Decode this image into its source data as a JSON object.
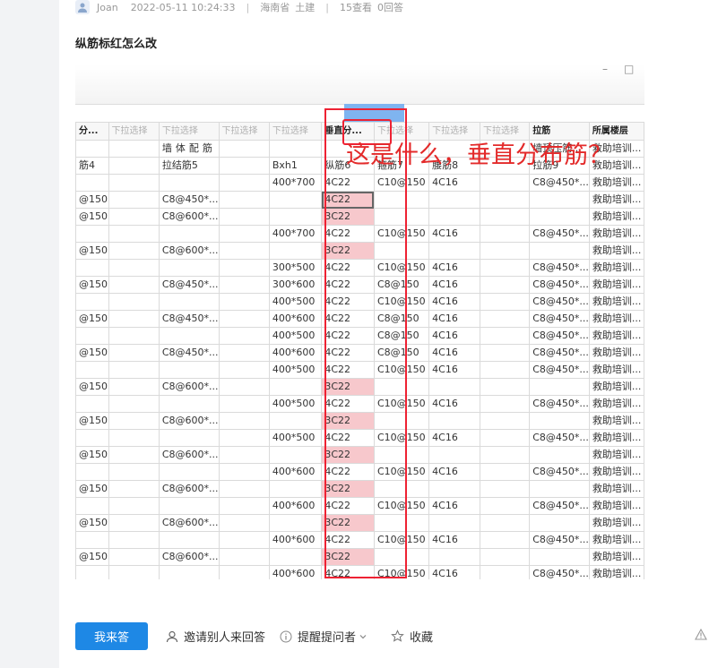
{
  "post": {
    "author": "Joan",
    "datetime": "2022-05-11 10:24:33",
    "separator": "|",
    "region": "海南省",
    "category": "土建",
    "views": "15查看",
    "answers": "0回答",
    "title": "纵筋标红怎么改"
  },
  "annotation": "这是什么，垂直分布筋？",
  "sheet": {
    "headers": [
      "分...",
      "下拉选择",
      "下拉选择",
      "下拉选择",
      "下拉选择",
      "垂直分...",
      "下拉选择",
      "下拉选择",
      "下拉选择",
      "拉筋",
      "所属楼层"
    ],
    "rows": [
      [
        "",
        "",
        "墙体配筋",
        "",
        "",
        "",
        "",
        "",
        "",
        "墙顶压筋...",
        "救助培训..."
      ],
      [
        "筋4",
        "",
        "拉结筋5",
        "",
        "Bxh1",
        "纵筋6",
        "箍筋7",
        "腰筋8",
        "",
        "拉筋9",
        "救助培训..."
      ],
      [
        "",
        "",
        "",
        "",
        "400*700",
        "4C22",
        "C10@150",
        "4C16",
        "",
        "C8@450*...",
        "救助培训..."
      ],
      [
        "@150",
        "",
        "C8@450*...",
        "",
        "",
        "4C22",
        "",
        "",
        "",
        "",
        "救助培训..."
      ],
      [
        "@150",
        "",
        "C8@600*...",
        "",
        "",
        "3C22",
        "",
        "",
        "",
        "",
        "救助培训..."
      ],
      [
        "",
        "",
        "",
        "",
        "400*700",
        "4C22",
        "C10@150",
        "4C16",
        "",
        "C8@450*...",
        "救助培训..."
      ],
      [
        "@150",
        "",
        "C8@600*...",
        "",
        "",
        "3C22",
        "",
        "",
        "",
        "",
        "救助培训..."
      ],
      [
        "",
        "",
        "",
        "",
        "300*500",
        "4C22",
        "C10@150",
        "4C16",
        "",
        "C8@450*...",
        "救助培训..."
      ],
      [
        "@150",
        "",
        "C8@450*...",
        "",
        "300*600",
        "4C22",
        "C8@150",
        "4C16",
        "",
        "C8@450*...",
        "救助培训..."
      ],
      [
        "",
        "",
        "",
        "",
        "400*500",
        "4C22",
        "C10@150",
        "4C16",
        "",
        "C8@450*...",
        "救助培训..."
      ],
      [
        "@150",
        "",
        "C8@450*...",
        "",
        "400*600",
        "4C22",
        "C8@150",
        "4C16",
        "",
        "C8@450*...",
        "救助培训..."
      ],
      [
        "",
        "",
        "",
        "",
        "400*500",
        "4C22",
        "C8@150",
        "4C16",
        "",
        "C8@450*...",
        "救助培训..."
      ],
      [
        "@150",
        "",
        "C8@450*...",
        "",
        "400*600",
        "4C22",
        "C8@150",
        "4C16",
        "",
        "C8@450*...",
        "救助培训..."
      ],
      [
        "",
        "",
        "",
        "",
        "400*500",
        "4C22",
        "C10@150",
        "4C16",
        "",
        "C8@450*...",
        "救助培训..."
      ],
      [
        "@150",
        "",
        "C8@600*...",
        "",
        "",
        "3C22",
        "",
        "",
        "",
        "",
        "救助培训..."
      ],
      [
        "",
        "",
        "",
        "",
        "400*500",
        "4C22",
        "C10@150",
        "4C16",
        "",
        "C8@450*...",
        "救助培训..."
      ],
      [
        "@150",
        "",
        "C8@600*...",
        "",
        "",
        "3C22",
        "",
        "",
        "",
        "",
        "救助培训..."
      ],
      [
        "",
        "",
        "",
        "",
        "400*500",
        "4C22",
        "C10@150",
        "4C16",
        "",
        "C8@450*...",
        "救助培训..."
      ],
      [
        "@150",
        "",
        "C8@600*...",
        "",
        "",
        "3C22",
        "",
        "",
        "",
        "",
        "救助培训..."
      ],
      [
        "",
        "",
        "",
        "",
        "400*600",
        "4C22",
        "C10@150",
        "4C16",
        "",
        "C8@450*...",
        "救助培训..."
      ],
      [
        "@150",
        "",
        "C8@600*...",
        "",
        "",
        "3C22",
        "",
        "",
        "",
        "",
        "救助培训..."
      ],
      [
        "",
        "",
        "",
        "",
        "400*600",
        "4C22",
        "C10@150",
        "4C16",
        "",
        "C8@450*...",
        "救助培训..."
      ],
      [
        "@150",
        "",
        "C8@600*...",
        "",
        "",
        "3C22",
        "",
        "",
        "",
        "",
        "救助培训..."
      ],
      [
        "",
        "",
        "",
        "",
        "400*600",
        "4C22",
        "C10@150",
        "4C16",
        "",
        "C8@450*...",
        "救助培训..."
      ],
      [
        "@150",
        "",
        "C8@600*...",
        "",
        "",
        "3C22",
        "",
        "",
        "",
        "",
        "救助培训..."
      ],
      [
        "",
        "",
        "",
        "",
        "400*600",
        "4C22",
        "C10@150",
        "4C16",
        "",
        "C8@450*...",
        "救助培训..."
      ]
    ],
    "highlight_color": "#f7c8cc",
    "column_header_highlight": "#7fb4f0"
  },
  "actions": {
    "answer": "我来答",
    "invite": "邀请别人来回答",
    "remind": "提醒提问者",
    "favorite": "收藏"
  },
  "colors": {
    "primary": "#1e88e5",
    "annotation_red": "#e32a2a"
  }
}
